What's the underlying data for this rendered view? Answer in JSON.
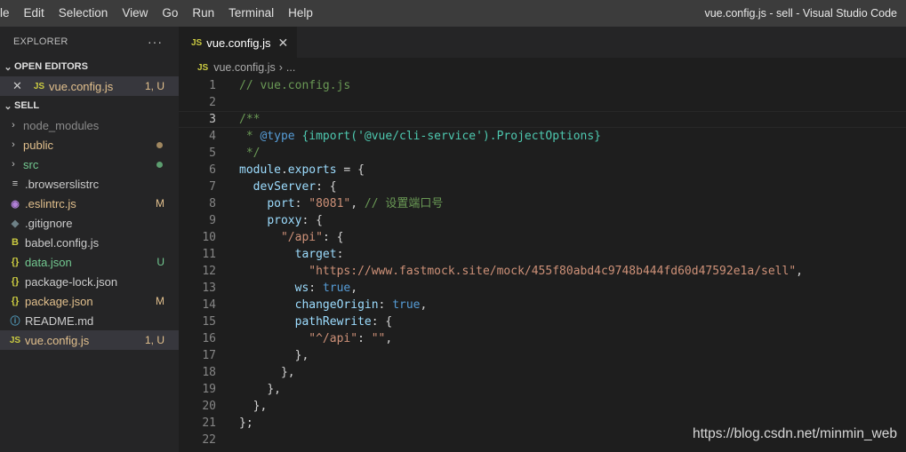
{
  "menu": [
    "le",
    "Edit",
    "Selection",
    "View",
    "Go",
    "Run",
    "Terminal",
    "Help"
  ],
  "window_title": "vue.config.js - sell - Visual Studio Code",
  "explorer": {
    "header": "EXPLORER",
    "more": "···",
    "open_editors_label": "OPEN EDITORS",
    "open_editor": {
      "close": "✕",
      "icon": "JS",
      "name": "vue.config.js",
      "status": "1, U"
    },
    "folder_label": "SELL",
    "items": [
      {
        "name": "node_modules",
        "chev": "›",
        "icon": "",
        "color": "#8b8b8b",
        "badge": "",
        "dot": ""
      },
      {
        "name": "public",
        "chev": "›",
        "icon": "",
        "color": "#e2c08d",
        "badge": "",
        "dot": "#a0875f"
      },
      {
        "name": "src",
        "chev": "›",
        "icon": "",
        "color": "#73c991",
        "badge": "",
        "dot": "#5c9e6f"
      },
      {
        "name": ".browserslistrc",
        "chev": "",
        "icon": "≡",
        "color": "#cccccc",
        "badge": "",
        "dot": ""
      },
      {
        "name": ".eslintrc.js",
        "chev": "",
        "icon": "◉",
        "color": "#e2c08d",
        "badge": "M",
        "dot": ""
      },
      {
        "name": ".gitignore",
        "chev": "",
        "icon": "◆",
        "color": "#cccccc",
        "badge": "",
        "dot": ""
      },
      {
        "name": "babel.config.js",
        "chev": "",
        "icon": "B",
        "color": "#cccccc",
        "badge": "",
        "dot": ""
      },
      {
        "name": "data.json",
        "chev": "",
        "icon": "{}",
        "color": "#73c991",
        "badge": "U",
        "dot": ""
      },
      {
        "name": "package-lock.json",
        "chev": "",
        "icon": "{}",
        "color": "#cccccc",
        "badge": "",
        "dot": ""
      },
      {
        "name": "package.json",
        "chev": "",
        "icon": "{}",
        "color": "#e2c08d",
        "badge": "M",
        "dot": ""
      },
      {
        "name": "README.md",
        "chev": "",
        "icon": "ⓘ",
        "color": "#cccccc",
        "badge": "",
        "dot": ""
      },
      {
        "name": "vue.config.js",
        "chev": "",
        "icon": "JS",
        "color": "#e2c08d",
        "badge": "1, U",
        "dot": ""
      }
    ]
  },
  "tab": {
    "icon": "JS",
    "name": "vue.config.js",
    "close": "✕"
  },
  "breadcrumb": {
    "icon": "JS",
    "file": "vue.config.js",
    "sep": "›",
    "rest": "..."
  },
  "code_lines": [
    [
      [
        "c",
        "// vue.config.js"
      ]
    ],
    [],
    [
      [
        "c",
        "/**"
      ]
    ],
    [
      [
        "c",
        " * "
      ],
      [
        "b",
        "@type"
      ],
      [
        "c",
        " "
      ],
      [
        "t",
        "{import('@vue/cli-service').ProjectOptions}"
      ]
    ],
    [
      [
        "c",
        " */"
      ]
    ],
    [
      [
        "k",
        "module"
      ],
      [
        "p",
        "."
      ],
      [
        "k",
        "exports"
      ],
      [
        "p",
        " = {"
      ]
    ],
    [
      [
        "g",
        "  "
      ],
      [
        "k",
        "devServer"
      ],
      [
        "p",
        ": {"
      ]
    ],
    [
      [
        "g",
        "    "
      ],
      [
        "k",
        "port"
      ],
      [
        "p",
        ": "
      ],
      [
        "s",
        "\"8081\""
      ],
      [
        "p",
        ", "
      ],
      [
        "c",
        "// 设置端口号"
      ]
    ],
    [
      [
        "g",
        "    "
      ],
      [
        "k",
        "proxy"
      ],
      [
        "p",
        ": {"
      ]
    ],
    [
      [
        "g",
        "      "
      ],
      [
        "s",
        "\"/api\""
      ],
      [
        "p",
        ": {"
      ]
    ],
    [
      [
        "g",
        "        "
      ],
      [
        "k",
        "target"
      ],
      [
        "p",
        ":"
      ]
    ],
    [
      [
        "g",
        "          "
      ],
      [
        "s",
        "\"https://www.fastmock.site/mock/455f80abd4c9748b444fd60d47592e1a/sell\""
      ],
      [
        "p",
        ","
      ]
    ],
    [
      [
        "g",
        "        "
      ],
      [
        "k",
        "ws"
      ],
      [
        "p",
        ": "
      ],
      [
        "b",
        "true"
      ],
      [
        "p",
        ","
      ]
    ],
    [
      [
        "g",
        "        "
      ],
      [
        "k",
        "changeOrigin"
      ],
      [
        "p",
        ": "
      ],
      [
        "b",
        "true"
      ],
      [
        "p",
        ","
      ]
    ],
    [
      [
        "g",
        "        "
      ],
      [
        "k",
        "pathRewrite"
      ],
      [
        "p",
        ": {"
      ]
    ],
    [
      [
        "g",
        "          "
      ],
      [
        "s",
        "\"^/api\""
      ],
      [
        "p",
        ": "
      ],
      [
        "s",
        "\"\""
      ],
      [
        "p",
        ","
      ]
    ],
    [
      [
        "g",
        "        "
      ],
      [
        "p",
        "},"
      ]
    ],
    [
      [
        "g",
        "      "
      ],
      [
        "p",
        "},"
      ]
    ],
    [
      [
        "g",
        "    "
      ],
      [
        "p",
        "},"
      ]
    ],
    [
      [
        "g",
        "  "
      ],
      [
        "p",
        "},"
      ]
    ],
    [
      [
        "p",
        "};"
      ]
    ],
    []
  ],
  "current_line": 3,
  "watermark": "https://blog.csdn.net/minmin_web"
}
